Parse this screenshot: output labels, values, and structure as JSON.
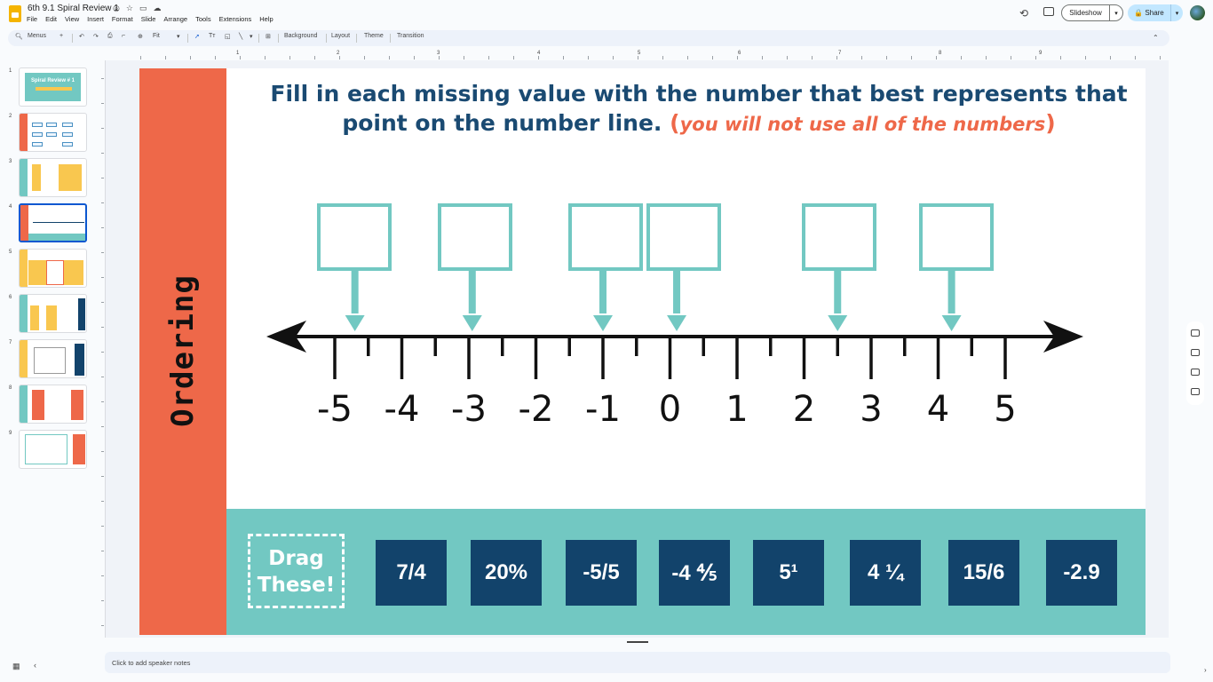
{
  "app": {
    "doc_title": "6th 9.1 Spiral Review 1",
    "menu": [
      "File",
      "Edit",
      "View",
      "Insert",
      "Format",
      "Slide",
      "Arrange",
      "Tools",
      "Extensions",
      "Help"
    ],
    "slideshow_label": "Slideshow",
    "share_label": "Share"
  },
  "toolbar": {
    "menus_label": "Menus",
    "zoom_label": "Fit",
    "background_label": "Background",
    "layout_label": "Layout",
    "theme_label": "Theme",
    "transition_label": "Transition"
  },
  "filmstrip": {
    "numbers": [
      "1",
      "2",
      "3",
      "4",
      "5",
      "6",
      "7",
      "8",
      "9"
    ],
    "active_index": 4,
    "slide1_title": "Spiral Review # 1"
  },
  "ruler": {
    "marks": [
      "1",
      "2",
      "3",
      "4",
      "5",
      "6",
      "7",
      "8",
      "9"
    ]
  },
  "slide": {
    "side_label": "Ordering",
    "title_main": "Fill in each missing value with the number that best represents that point on the number line.",
    "title_note_open": "(",
    "title_note": "you will not use all of the numbers",
    "title_note_close": ")",
    "number_line_labels": [
      "-5",
      "-4",
      "-3",
      "-2",
      "-1",
      "0",
      "1",
      "2",
      "3",
      "4",
      "5"
    ],
    "drag_label": "Drag These!",
    "tiles": [
      "7/4",
      "20%",
      "-5/5",
      "-4 ⅘",
      "5¹",
      "4 ¼",
      "15/6",
      "-2.9"
    ]
  },
  "notes": {
    "placeholder": "Click to add speaker notes"
  },
  "colors": {
    "accent_orange": "#ee6849",
    "navy": "#12436b",
    "teal": "#72c8c2",
    "title_blue": "#1a4a72"
  }
}
